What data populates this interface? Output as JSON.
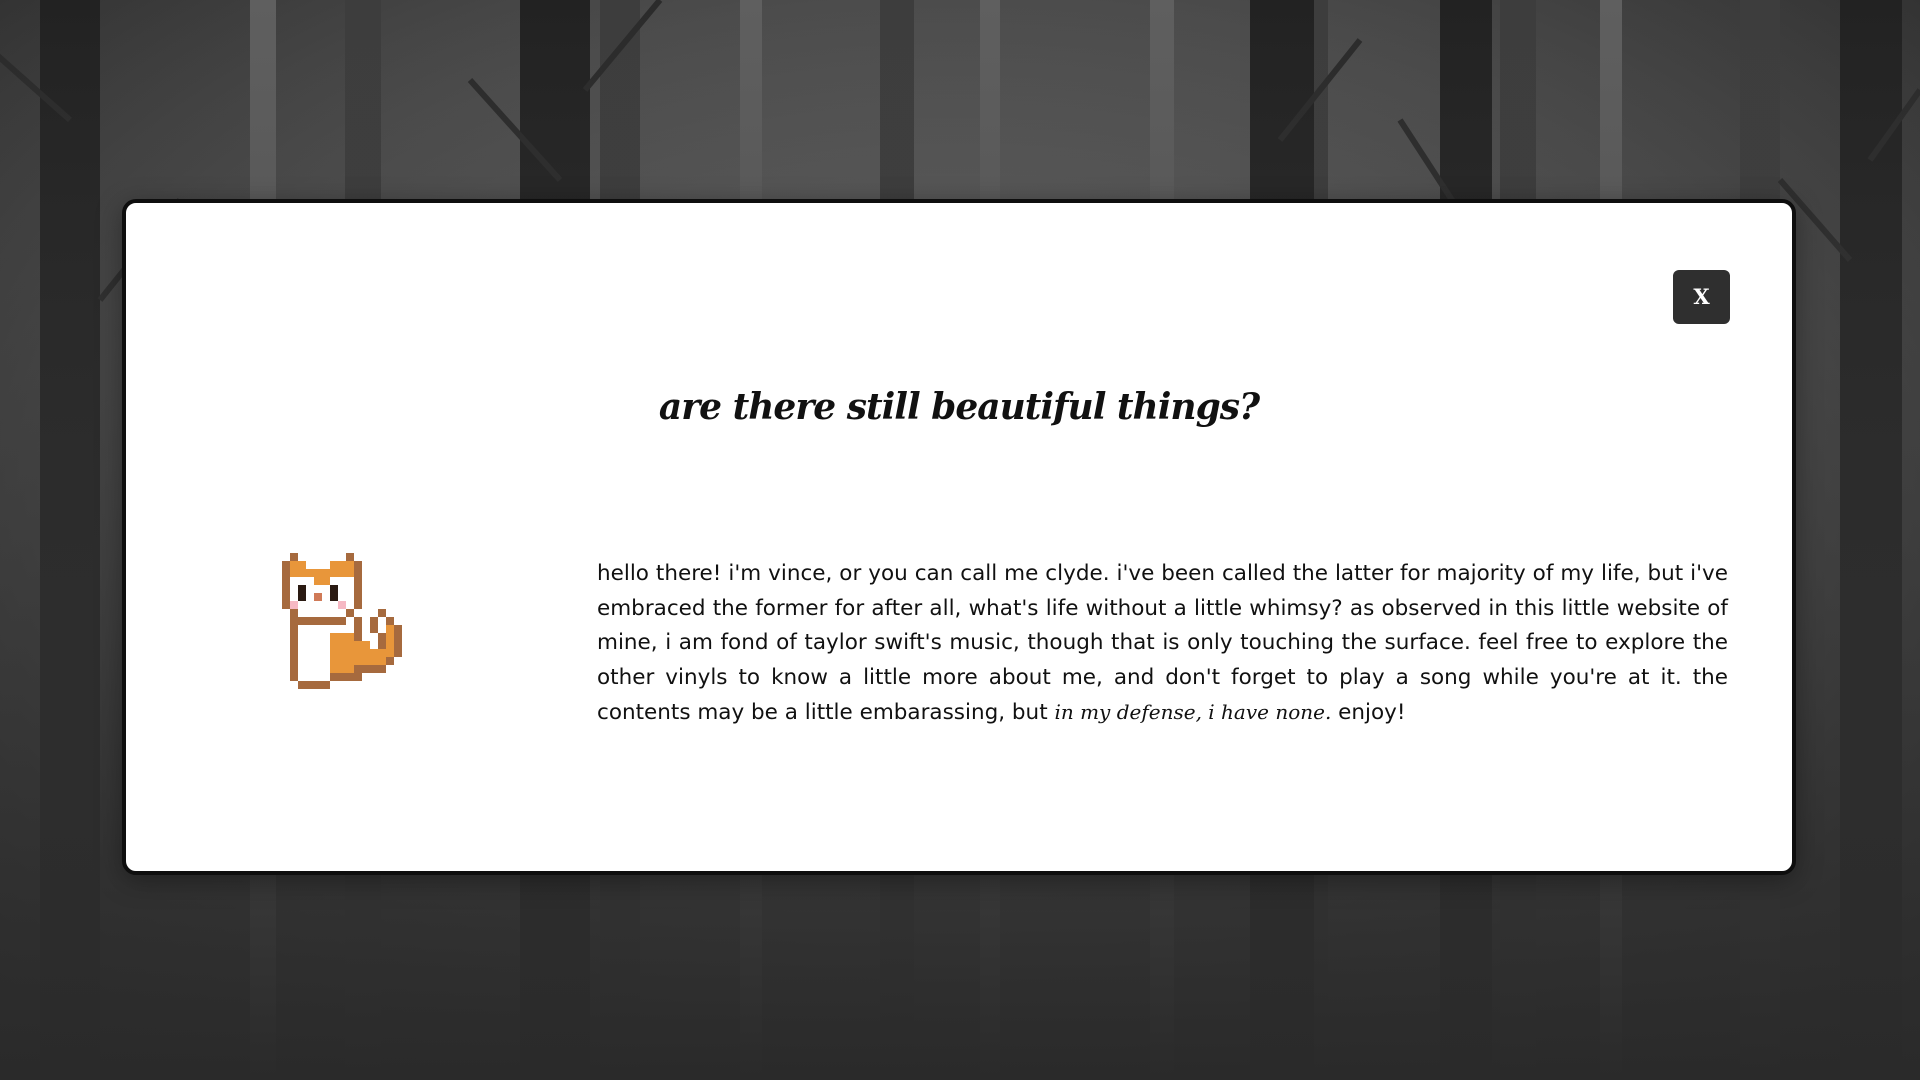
{
  "background": {
    "scene": "misty-forest-backdrop"
  },
  "modal": {
    "close_label": "X",
    "title": "are there still beautiful things?",
    "avatar_icon": "pixel-cat-icon",
    "intro_text": "hello there! i'm vince, or you can call me clyde. i've been called the latter for majority of my life, but i've embraced the former for after all, what's life without a little whimsy? as observed in this little website of mine, i am fond of taylor swift's music, though that is only touching the surface. feel free to explore the other vinyls to know a little more about me, and don't forget to play a song while you're at it. the contents may be a little embarassing, but ",
    "intro_aside": "in my defense, i have none.",
    "intro_end": " enjoy!"
  },
  "colors": {
    "modal_background": "#ffffff",
    "modal_border": "#0e0e0e",
    "close_button": "#2f2f2f",
    "text": "#111111",
    "cat_orange": "#e8963a",
    "cat_outline": "#a66a3e"
  }
}
